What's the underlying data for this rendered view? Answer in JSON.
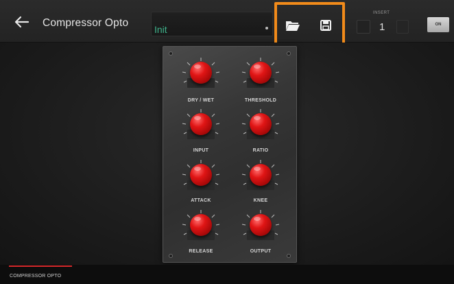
{
  "header": {
    "title": "Compressor Opto",
    "preset_value": "Init",
    "insert_label": "INSERT",
    "insert_number": "1",
    "on_label": "ON"
  },
  "knobs": [
    {
      "label": "DRY / WET"
    },
    {
      "label": "THRESHOLD"
    },
    {
      "label": "INPUT"
    },
    {
      "label": "RATIO"
    },
    {
      "label": "ATTACK"
    },
    {
      "label": "KNEE"
    },
    {
      "label": "RELEASE"
    },
    {
      "label": "OUTPUT"
    }
  ],
  "bottom": {
    "tab_label": "COMPRESSOR OPTO"
  },
  "colors": {
    "highlight": "#f28b1a",
    "preset_text": "#3fb58d",
    "knob_red": "#e01515",
    "tab_accent": "#d6282b"
  }
}
